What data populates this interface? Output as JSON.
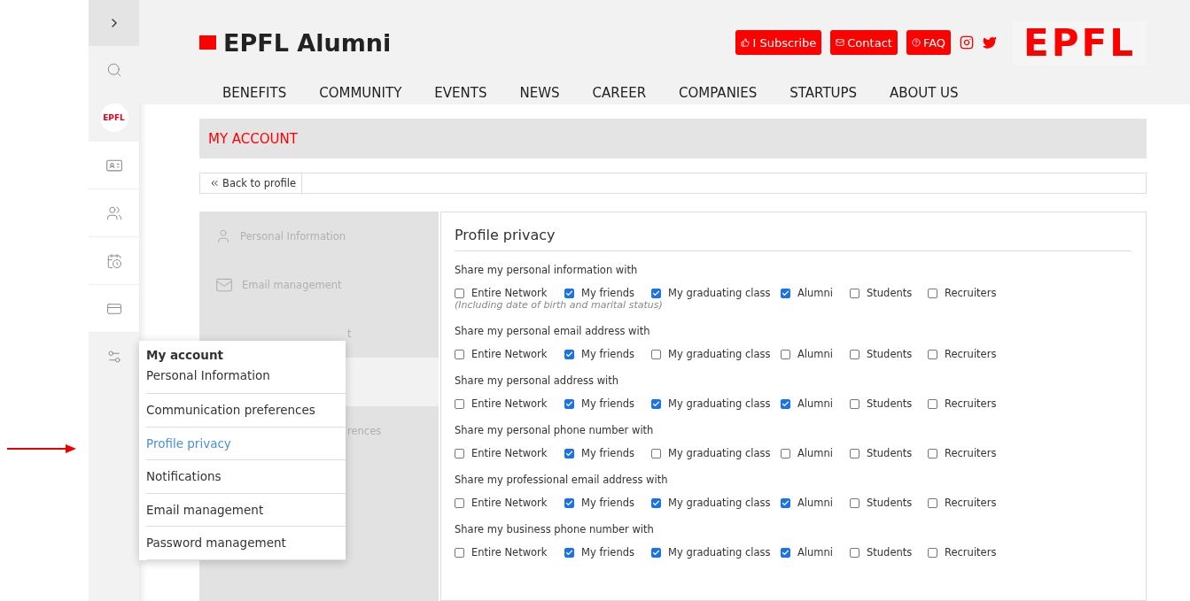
{
  "header": {
    "title": "EPFL Alumni",
    "buttons": [
      {
        "kind": "subscribe",
        "label": "I Subscribe"
      },
      {
        "kind": "contact",
        "label": "Contact"
      },
      {
        "kind": "faq",
        "label": "FAQ"
      }
    ],
    "logo_text": "EPFL"
  },
  "sidebar": {
    "avatar_text": "EPFL"
  },
  "nav": [
    "BENEFITS",
    "COMMUNITY",
    "EVENTS",
    "NEWS",
    "CAREER",
    "COMPANIES",
    "STARTUPS",
    "ABOUT US"
  ],
  "page_title": "MY ACCOUNT",
  "back_link": "Back to profile",
  "side_menu": [
    {
      "kind": "person",
      "label": "Personal Information",
      "selected": false
    },
    {
      "kind": "mail",
      "label": "Email management",
      "selected": false
    },
    {
      "kind": "covered",
      "label": "t",
      "selected": false
    },
    {
      "kind": "covered",
      "selected": true
    },
    {
      "kind": "covered",
      "label": "rences",
      "selected": false
    }
  ],
  "popover": {
    "title": "My account",
    "items": [
      {
        "label": "Personal Information",
        "selected": false
      },
      {
        "label": "Communication preferences",
        "selected": false
      },
      {
        "label": "Profile privacy",
        "selected": true
      },
      {
        "label": "Notifications",
        "selected": false
      },
      {
        "label": "Email management",
        "selected": false
      },
      {
        "label": "Password management",
        "selected": false
      }
    ]
  },
  "section_title": "Profile privacy",
  "groups": [
    {
      "label": "Share my personal information with",
      "note": "(Including date of birth and marital status)",
      "options": [
        {
          "label": "Entire Network",
          "checked": false
        },
        {
          "label": "My friends",
          "checked": true
        },
        {
          "label": "My graduating class",
          "checked": true
        },
        {
          "label": "Alumni",
          "checked": true
        },
        {
          "label": "Students",
          "checked": false
        },
        {
          "label": "Recruiters",
          "checked": false
        }
      ]
    },
    {
      "label": "Share my personal email address with",
      "options": [
        {
          "label": "Entire Network",
          "checked": false
        },
        {
          "label": "My friends",
          "checked": true
        },
        {
          "label": "My graduating class",
          "checked": false
        },
        {
          "label": "Alumni",
          "checked": false
        },
        {
          "label": "Students",
          "checked": false
        },
        {
          "label": "Recruiters",
          "checked": false
        }
      ]
    },
    {
      "label": "Share my personal address with",
      "options": [
        {
          "label": "Entire Network",
          "checked": false
        },
        {
          "label": "My friends",
          "checked": true
        },
        {
          "label": "My graduating class",
          "checked": true
        },
        {
          "label": "Alumni",
          "checked": true
        },
        {
          "label": "Students",
          "checked": false
        },
        {
          "label": "Recruiters",
          "checked": false
        }
      ]
    },
    {
      "label": "Share my personal phone number with",
      "options": [
        {
          "label": "Entire Network",
          "checked": false
        },
        {
          "label": "My friends",
          "checked": true
        },
        {
          "label": "My graduating class",
          "checked": false
        },
        {
          "label": "Alumni",
          "checked": false
        },
        {
          "label": "Students",
          "checked": false
        },
        {
          "label": "Recruiters",
          "checked": false
        }
      ]
    },
    {
      "label": "Share my professional email address with",
      "options": [
        {
          "label": "Entire Network",
          "checked": false
        },
        {
          "label": "My friends",
          "checked": true
        },
        {
          "label": "My graduating class",
          "checked": true
        },
        {
          "label": "Alumni",
          "checked": true
        },
        {
          "label": "Students",
          "checked": false
        },
        {
          "label": "Recruiters",
          "checked": false
        }
      ]
    },
    {
      "label": "Share my business phone number with",
      "options": [
        {
          "label": "Entire Network",
          "checked": false
        },
        {
          "label": "My friends",
          "checked": true
        },
        {
          "label": "My graduating class",
          "checked": true
        },
        {
          "label": "Alumni",
          "checked": true
        },
        {
          "label": "Students",
          "checked": false
        },
        {
          "label": "Recruiters",
          "checked": false
        }
      ]
    }
  ]
}
